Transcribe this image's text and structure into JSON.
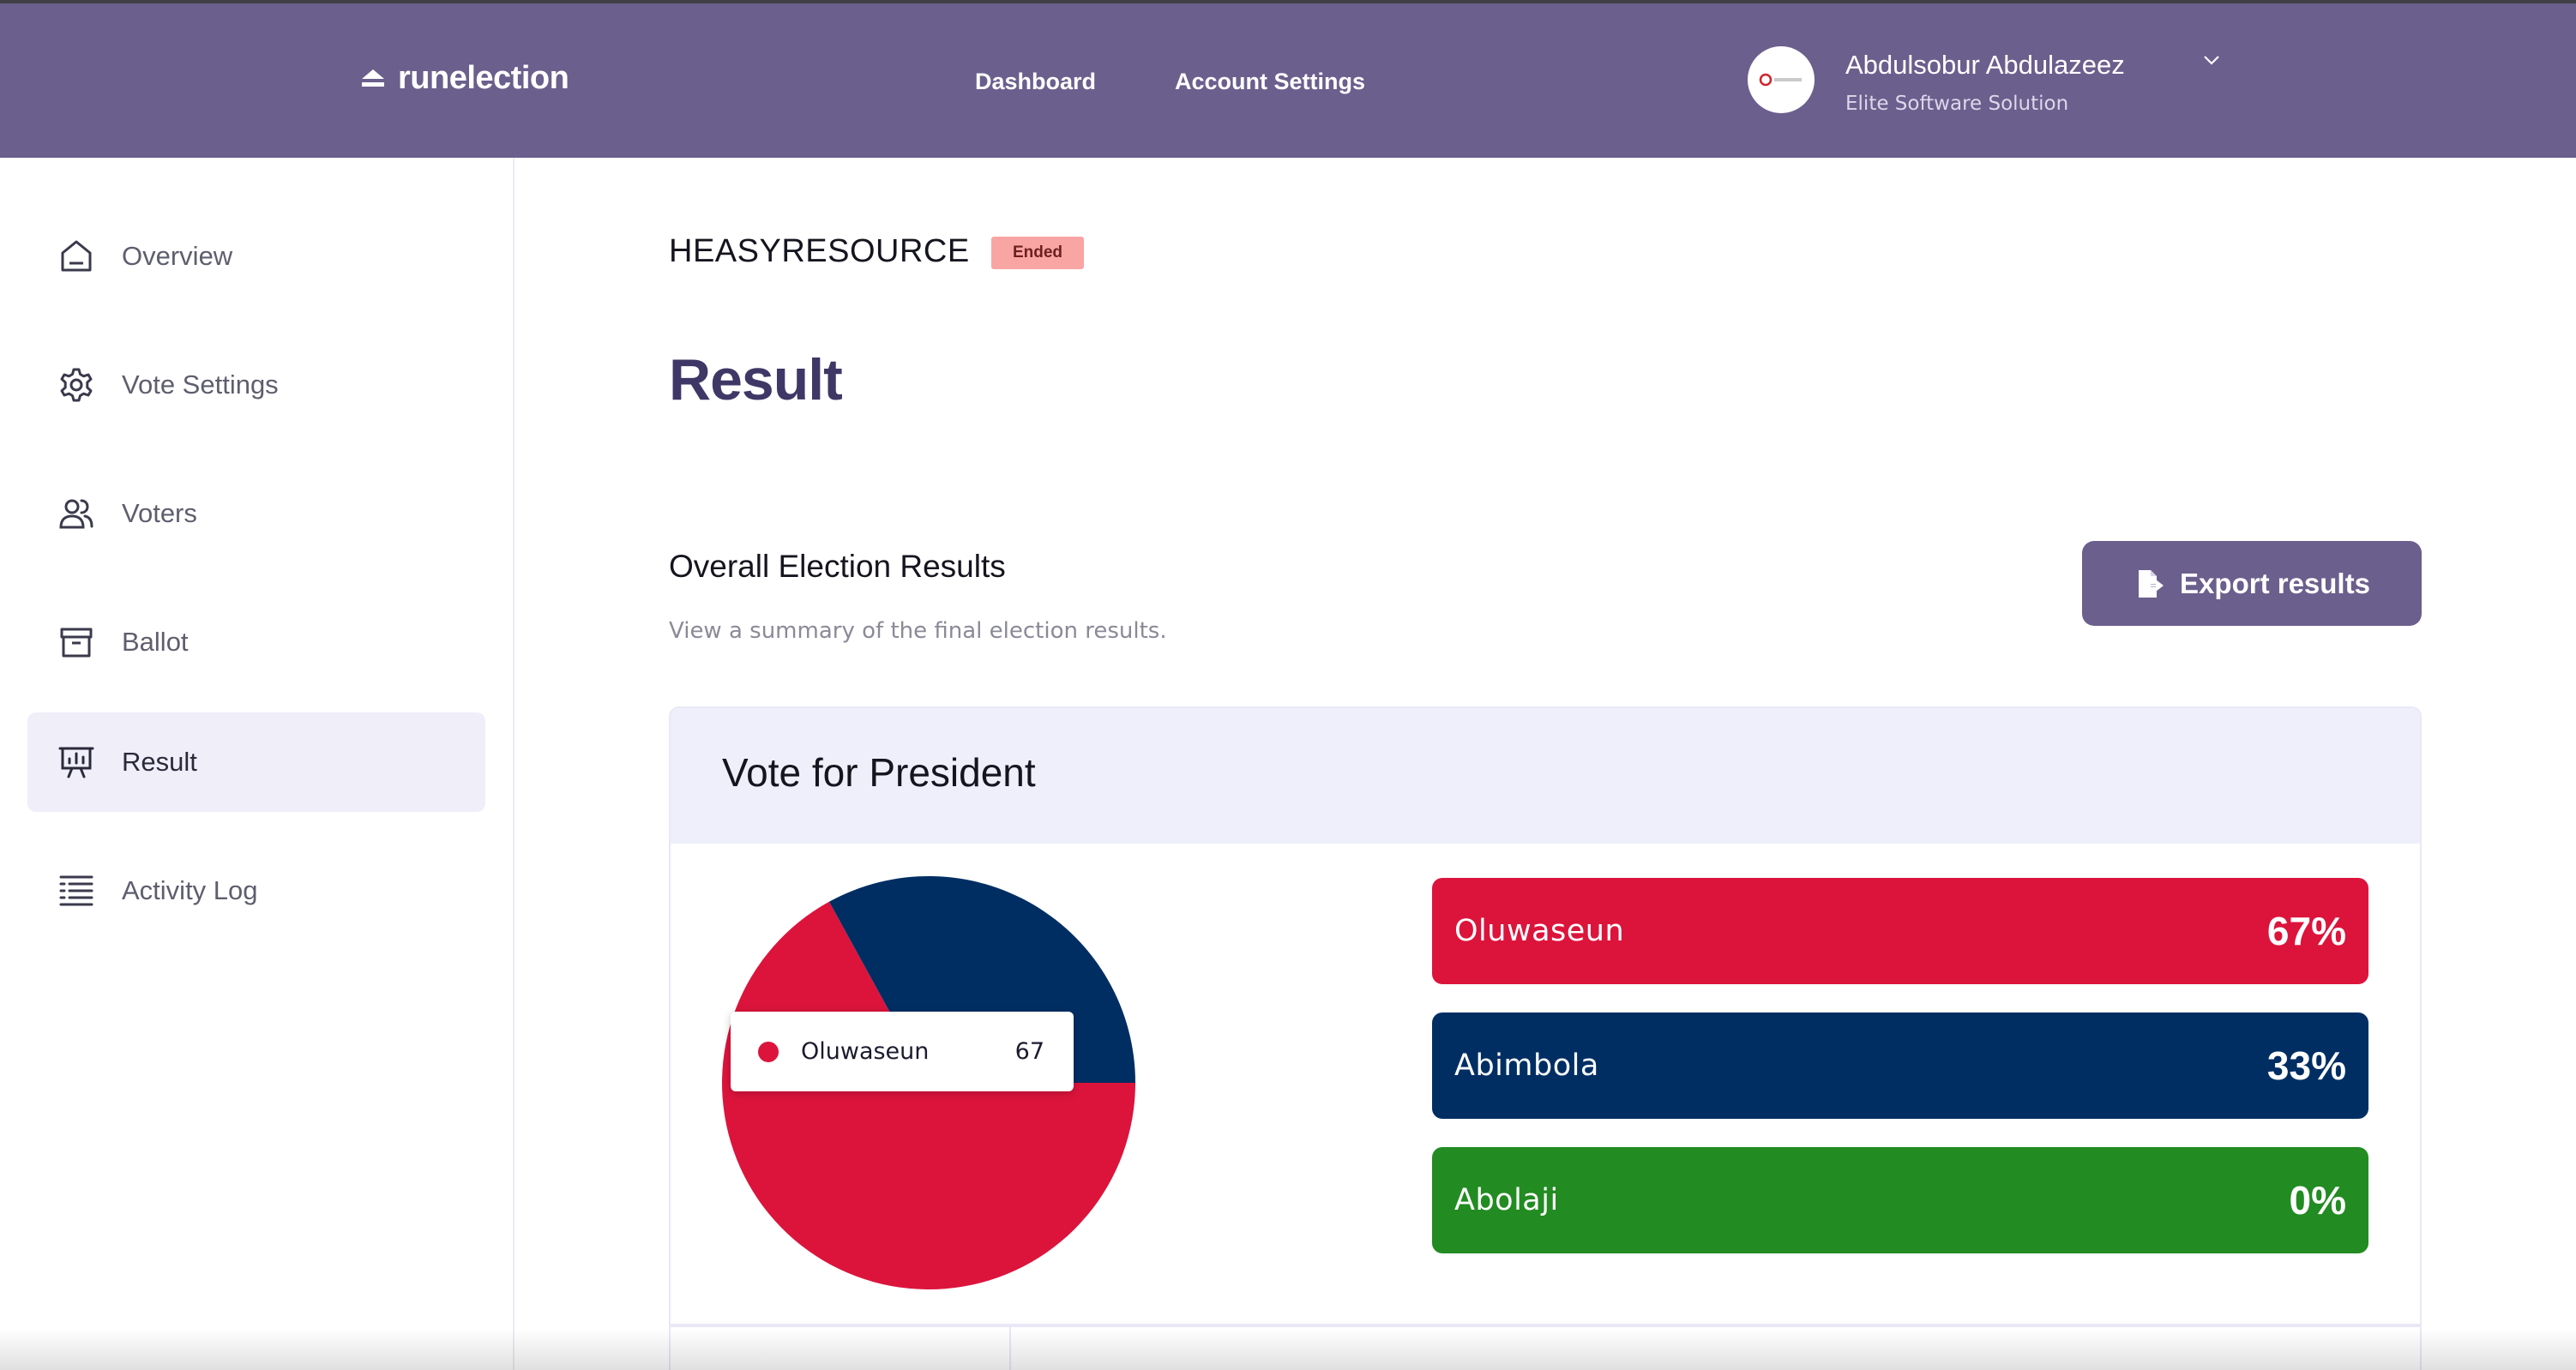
{
  "app": {
    "logo_text": "runelection"
  },
  "nav": {
    "dashboard": "Dashboard",
    "account_settings": "Account Settings"
  },
  "user": {
    "name": "Abdulsobur Abdulazeez",
    "org": "Elite Software Solution"
  },
  "sidebar": {
    "items": [
      {
        "label": "Overview",
        "icon": "home-icon",
        "active": false
      },
      {
        "label": "Vote Settings",
        "icon": "gear-icon",
        "active": false
      },
      {
        "label": "Voters",
        "icon": "users-icon",
        "active": false
      },
      {
        "label": "Ballot",
        "icon": "archive-box-icon",
        "active": false
      },
      {
        "label": "Result",
        "icon": "presentation-chart-icon",
        "active": true
      },
      {
        "label": "Activity Log",
        "icon": "list-icon",
        "active": false
      }
    ]
  },
  "election": {
    "name": "HEASYRESOURCE",
    "status": "Ended"
  },
  "page": {
    "title": "Result",
    "section_title": "Overall Election Results",
    "section_subtitle": "View a summary of the final election results.",
    "export_label": "Export results"
  },
  "card": {
    "title": "Vote for President",
    "tooltip": {
      "name": "Oluwaseun",
      "value": "67"
    },
    "results": [
      {
        "name": "Oluwaseun",
        "percent": "67%",
        "color": "#dc143c"
      },
      {
        "name": "Abimbola",
        "percent": "33%",
        "color": "#002e63"
      },
      {
        "name": "Abolaji",
        "percent": "0%",
        "color": "#228b22"
      }
    ]
  },
  "chart_data": {
    "type": "pie",
    "categories": [
      "Oluwaseun",
      "Abimbola",
      "Abolaji"
    ],
    "values": [
      67,
      33,
      0
    ],
    "colors": [
      "#dc143c",
      "#002e63",
      "#228b22"
    ]
  }
}
